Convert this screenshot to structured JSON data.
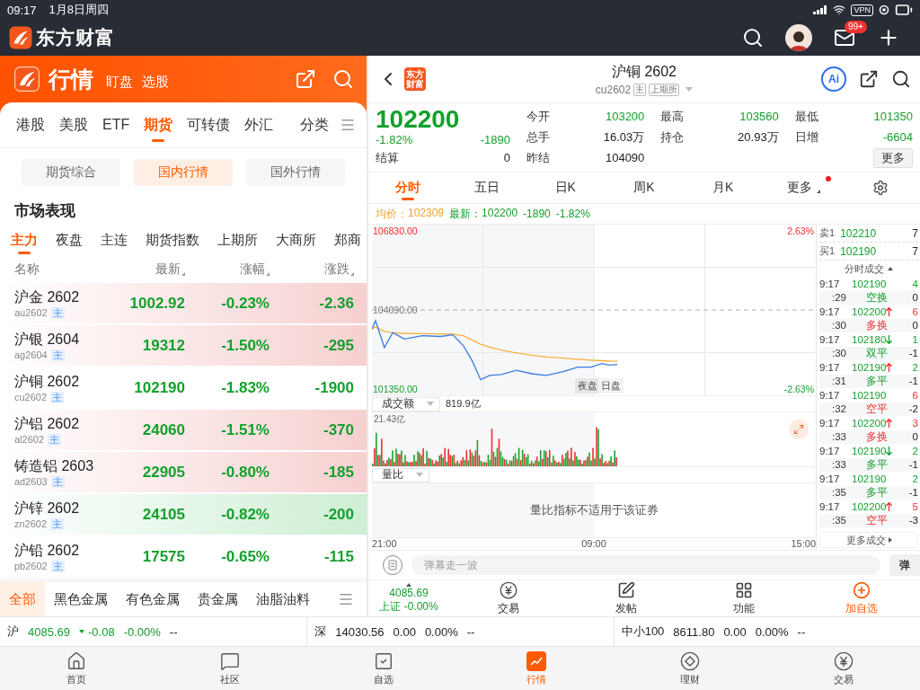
{
  "status_bar": {
    "time": "09:17",
    "date": "1月8日周四",
    "vpn": "VPN"
  },
  "app_header": {
    "logo_text": "东方财富",
    "mail_badge": "99+"
  },
  "market": {
    "title": "行情",
    "links": [
      "盯盘",
      "选股"
    ],
    "tabs": [
      {
        "label": "港股",
        "selected": false
      },
      {
        "label": "美股",
        "selected": false
      },
      {
        "label": "ETF",
        "selected": false
      },
      {
        "label": "期货",
        "selected": true
      },
      {
        "label": "可转债",
        "selected": false
      },
      {
        "label": "外汇",
        "selected": false
      }
    ],
    "category_label": "分类",
    "segments": [
      {
        "label": "期货综合",
        "selected": false
      },
      {
        "label": "国内行情",
        "selected": true
      },
      {
        "label": "国外行情",
        "selected": false
      }
    ],
    "section_title": "市场表现",
    "exchange_tabs": [
      {
        "label": "主力",
        "selected": true
      },
      {
        "label": "夜盘",
        "selected": false
      },
      {
        "label": "主连",
        "selected": false
      },
      {
        "label": "期货指数",
        "selected": false
      },
      {
        "label": "上期所",
        "selected": false
      },
      {
        "label": "大商所",
        "selected": false
      },
      {
        "label": "郑商",
        "selected": false
      }
    ],
    "columns": [
      {
        "label": "名称",
        "sortable": false
      },
      {
        "label": "最新",
        "sortable": true
      },
      {
        "label": "涨幅",
        "sortable": true
      },
      {
        "label": "涨跌",
        "sortable": true
      }
    ],
    "rows": [
      {
        "name": "沪金 2602",
        "code": "au2602",
        "tag": "主",
        "last": "1002.92",
        "change_pct": "-0.23%",
        "change": "-2.36",
        "falling": true,
        "color": "#f7d0d0"
      },
      {
        "name": "沪银 2604",
        "code": "ag2604",
        "tag": "主",
        "last": "19312",
        "change_pct": "-1.50%",
        "change": "-295",
        "falling": true,
        "color": "#f7d0d0"
      },
      {
        "name": "沪铜 2602",
        "code": "cu2602",
        "tag": "主",
        "last": "102190",
        "change_pct": "-1.83%",
        "change": "-1900",
        "falling": true,
        "color": "#ffffff"
      },
      {
        "name": "沪铝 2602",
        "code": "al2602",
        "tag": "主",
        "last": "24060",
        "change_pct": "-1.51%",
        "change": "-370",
        "falling": true,
        "color": "#f7d0d0"
      },
      {
        "name": "铸造铝 2603",
        "code": "ad2603",
        "tag": "主",
        "last": "22905",
        "change_pct": "-0.80%",
        "change": "-185",
        "falling": true,
        "color": "#f7d0d0"
      },
      {
        "name": "沪锌 2602",
        "code": "zn2602",
        "tag": "主",
        "last": "24105",
        "change_pct": "-0.82%",
        "change": "-200",
        "falling": true,
        "color": "#cdeed4"
      },
      {
        "name": "沪铅 2602",
        "code": "pb2602",
        "tag": "主",
        "last": "17575",
        "change_pct": "-0.65%",
        "change": "-115",
        "falling": true,
        "color": "#ffffff"
      }
    ],
    "categories": [
      {
        "label": "全部",
        "selected": true
      },
      {
        "label": "黑色金属",
        "selected": false
      },
      {
        "label": "有色金属",
        "selected": false
      },
      {
        "label": "贵金属",
        "selected": false
      },
      {
        "label": "油脂油料",
        "selected": false
      }
    ]
  },
  "quote": {
    "logo_text": "东方财富",
    "title": "沪铜 2602",
    "code": "cu2602",
    "tags": [
      "主",
      "上期所"
    ],
    "ai_label": "Ai",
    "price": "102200",
    "change_pct": "-1.82%",
    "change": "-1890",
    "falling": true,
    "stats": [
      {
        "label": "今开",
        "value": "103200",
        "falling": true
      },
      {
        "label": "最高",
        "value": "103560",
        "falling": true
      },
      {
        "label": "最低",
        "value": "101350",
        "falling": true
      },
      {
        "label": "总手",
        "value": "16.03万",
        "falling": false
      },
      {
        "label": "持仓",
        "value": "20.93万",
        "falling": false
      },
      {
        "label": "日增",
        "value": "-6604",
        "falling": true
      }
    ],
    "extra_stats": [
      {
        "label": "结算",
        "value": "0",
        "falling": false
      },
      {
        "label": "昨结",
        "value": "104090",
        "falling": false
      }
    ],
    "more_button": "更多"
  },
  "chart_tabs": [
    {
      "label": "分时",
      "selected": true,
      "dot": false
    },
    {
      "label": "五日",
      "selected": false,
      "dot": false
    },
    {
      "label": "日K",
      "selected": false,
      "dot": false
    },
    {
      "label": "周K",
      "selected": false,
      "dot": false
    },
    {
      "label": "月K",
      "selected": false,
      "dot": false
    },
    {
      "label": "更多",
      "selected": false,
      "dot": true
    }
  ],
  "info_line": {
    "avg_label": "均价：",
    "avg": "102309",
    "latest_label": "最新：",
    "latest": "102200",
    "latest_change": "-1890",
    "latest_pct": "-1.82%"
  },
  "chart": {
    "right_labels": [
      "2.63%",
      "-2.63%"
    ],
    "sessions": [
      "夜盘",
      "日盘"
    ],
    "time_labels": [
      "21:00",
      "09:00",
      "15:00"
    ],
    "price_labels": [
      "106830.00",
      "104090.00",
      "101350.00"
    ]
  },
  "volume": {
    "indicator": "成交额",
    "total": "819.9亿",
    "max_label": "21.43亿"
  },
  "ratio": {
    "indicator": "量比",
    "message": "量比指标不适用于该证券"
  },
  "book": [
    {
      "label": "卖1",
      "price": "102210",
      "volume": "7"
    },
    {
      "label": "买1",
      "price": "102190",
      "volume": "7"
    }
  ],
  "trades_title": "分时成交",
  "trades": [
    {
      "time": "9:17",
      "second": ":29",
      "price": "102190",
      "uptick": false,
      "downtick": false,
      "volume": "4",
      "buy": false,
      "nature": "空换",
      "oi_change": "0"
    },
    {
      "time": "9:17",
      "second": ":30",
      "price": "102200",
      "uptick": true,
      "downtick": false,
      "volume": "6",
      "buy": true,
      "nature": "多换",
      "oi_change": "0"
    },
    {
      "time": "9:17",
      "second": ":30",
      "price": "102180",
      "uptick": false,
      "downtick": true,
      "volume": "1",
      "buy": false,
      "nature": "双平",
      "oi_change": "-1"
    },
    {
      "time": "9:17",
      "second": ":31",
      "price": "102190",
      "uptick": true,
      "downtick": false,
      "volume": "2",
      "buy": false,
      "nature": "多平",
      "oi_change": "-1"
    },
    {
      "time": "9:17",
      "second": ":32",
      "price": "102190",
      "uptick": false,
      "downtick": false,
      "volume": "6",
      "buy": true,
      "nature": "空平",
      "oi_change": "-2"
    },
    {
      "time": "9:17",
      "second": ":33",
      "price": "102200",
      "uptick": true,
      "downtick": false,
      "volume": "3",
      "buy": true,
      "nature": "多换",
      "oi_change": "0"
    },
    {
      "time": "9:17",
      "second": ":33",
      "price": "102190",
      "uptick": false,
      "downtick": true,
      "volume": "2",
      "buy": false,
      "nature": "多平",
      "oi_change": "-1"
    },
    {
      "time": "9:17",
      "second": ":35",
      "price": "102190",
      "uptick": false,
      "downtick": false,
      "volume": "2",
      "buy": false,
      "nature": "多平",
      "oi_change": "-1"
    },
    {
      "time": "9:17",
      "second": ":35",
      "price": "102200",
      "uptick": true,
      "downtick": false,
      "volume": "5",
      "buy": true,
      "nature": "空平",
      "oi_change": "-3"
    }
  ],
  "more_trades": "更多成交",
  "comment_bar": {
    "placeholder": "弹幕走一波",
    "send": "弹"
  },
  "action_bar": {
    "index_value": "4085.69",
    "index_name": "上证",
    "index_pct": "-0.00%",
    "actions": [
      {
        "label": "交易",
        "kind": "trade",
        "accent": false
      },
      {
        "label": "发帖",
        "kind": "post",
        "accent": false
      },
      {
        "label": "功能",
        "kind": "apps",
        "accent": false
      },
      {
        "label": "加自选",
        "kind": "add",
        "accent": true
      }
    ]
  },
  "indices": [
    {
      "name": "沪",
      "value": "4085.69",
      "change": "-0.08",
      "pct": "-0.00%",
      "extra": "--",
      "falling": true
    },
    {
      "name": "深",
      "value": "14030.56",
      "change": "0.00",
      "pct": "0.00%",
      "extra": "--",
      "falling": false
    },
    {
      "name": "中小100",
      "value": "8611.80",
      "change": "0.00",
      "pct": "0.00%",
      "extra": "--",
      "falling": false
    }
  ],
  "nav": [
    {
      "label": "首页",
      "kind": "home",
      "selected": false
    },
    {
      "label": "社区",
      "kind": "community",
      "selected": false
    },
    {
      "label": "自选",
      "kind": "watchlist",
      "selected": false
    },
    {
      "label": "行情",
      "kind": "market",
      "selected": true
    },
    {
      "label": "理财",
      "kind": "wealth",
      "selected": false
    },
    {
      "label": "交易",
      "kind": "trade",
      "selected": false
    }
  ]
}
